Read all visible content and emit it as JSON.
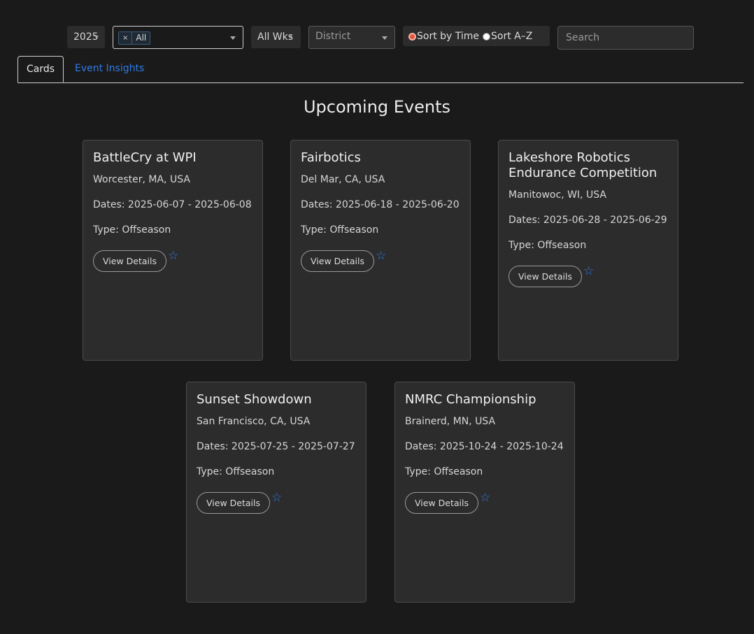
{
  "filters": {
    "year": "2025",
    "event_types_chip": "All",
    "chip_remove": "×",
    "weeks": "All Wks",
    "district_placeholder": "District",
    "sort_options": [
      "Sort by Time",
      "Sort A–Z"
    ],
    "sort_selected": "Sort by Time",
    "search_placeholder": "Search"
  },
  "tabs": [
    {
      "label": "Cards",
      "active": true
    },
    {
      "label": "Event Insights",
      "active": false
    }
  ],
  "page_title": "Upcoming Events",
  "cards": [
    {
      "name": "BattleCry at WPI",
      "location": "Worcester, MA, USA",
      "dates": "Dates: 2025-06-07 - 2025-06-08",
      "type": "Type: Offseason",
      "button": "View Details",
      "star": "☆"
    },
    {
      "name": "Fairbotics",
      "location": "Del Mar, CA, USA",
      "dates": "Dates: 2025-06-18 - 2025-06-20",
      "type": "Type: Offseason",
      "button": "View Details",
      "star": "☆"
    },
    {
      "name": "Lakeshore Robotics Endurance Competition",
      "location": "Manitowoc, WI, USA",
      "dates": "Dates: 2025-06-28 - 2025-06-29",
      "type": "Type: Offseason",
      "button": "View Details",
      "star": "☆"
    },
    {
      "name": "Sunset Showdown",
      "location": "San Francisco, CA, USA",
      "dates": "Dates: 2025-07-25 - 2025-07-27",
      "type": "Type: Offseason",
      "button": "View Details",
      "star": "☆"
    },
    {
      "name": "NMRC Championship",
      "location": "Brainerd, MN, USA",
      "dates": "Dates: 2025-10-24 - 2025-10-24",
      "type": "Type: Offseason",
      "button": "View Details",
      "star": "☆"
    }
  ],
  "colors": {
    "accent": "#2f7be6",
    "radio_selected": "#e5533c",
    "card_bg": "#2c2c2c",
    "page_bg": "#1a1a1a"
  }
}
